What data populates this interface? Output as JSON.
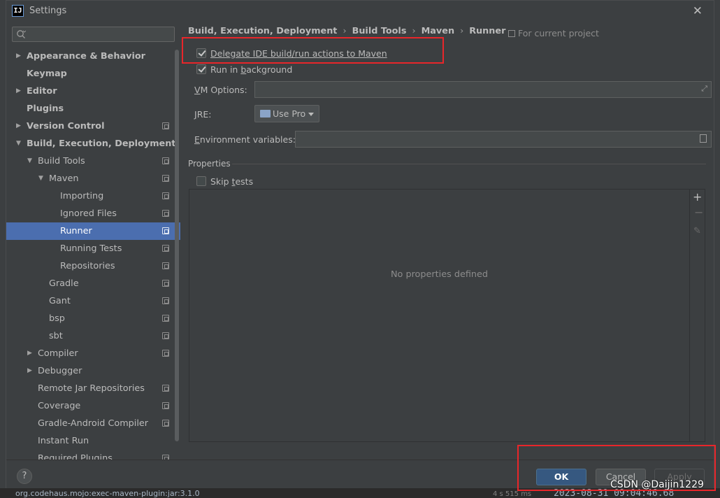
{
  "window": {
    "title": "Settings",
    "app_icon": "intellij-idea-icon"
  },
  "search": {
    "placeholder": ""
  },
  "nav": {
    "items": [
      {
        "label": "Appearance & Behavior",
        "level": 0,
        "arrow": "right",
        "bold": true,
        "project": false
      },
      {
        "label": "Keymap",
        "level": 0,
        "arrow": "",
        "bold": true,
        "project": false
      },
      {
        "label": "Editor",
        "level": 0,
        "arrow": "right",
        "bold": true,
        "project": false
      },
      {
        "label": "Plugins",
        "level": 0,
        "arrow": "",
        "bold": true,
        "project": false
      },
      {
        "label": "Version Control",
        "level": 0,
        "arrow": "right",
        "bold": true,
        "project": true
      },
      {
        "label": "Build, Execution, Deployment",
        "level": 0,
        "arrow": "down",
        "bold": true,
        "project": false
      },
      {
        "label": "Build Tools",
        "level": 1,
        "arrow": "down",
        "bold": false,
        "project": true
      },
      {
        "label": "Maven",
        "level": 2,
        "arrow": "down",
        "bold": false,
        "project": true
      },
      {
        "label": "Importing",
        "level": 3,
        "arrow": "",
        "bold": false,
        "project": true
      },
      {
        "label": "Ignored Files",
        "level": 3,
        "arrow": "",
        "bold": false,
        "project": true
      },
      {
        "label": "Runner",
        "level": 3,
        "arrow": "",
        "bold": false,
        "project": true,
        "selected": true
      },
      {
        "label": "Running Tests",
        "level": 3,
        "arrow": "",
        "bold": false,
        "project": true
      },
      {
        "label": "Repositories",
        "level": 3,
        "arrow": "",
        "bold": false,
        "project": true
      },
      {
        "label": "Gradle",
        "level": 2,
        "arrow": "",
        "bold": false,
        "project": true
      },
      {
        "label": "Gant",
        "level": 2,
        "arrow": "",
        "bold": false,
        "project": true
      },
      {
        "label": "bsp",
        "level": 2,
        "arrow": "",
        "bold": false,
        "project": true
      },
      {
        "label": "sbt",
        "level": 2,
        "arrow": "",
        "bold": false,
        "project": true
      },
      {
        "label": "Compiler",
        "level": 1,
        "arrow": "right",
        "bold": false,
        "project": true
      },
      {
        "label": "Debugger",
        "level": 1,
        "arrow": "right",
        "bold": false,
        "project": false
      },
      {
        "label": "Remote Jar Repositories",
        "level": 1,
        "arrow": "",
        "bold": false,
        "project": true
      },
      {
        "label": "Coverage",
        "level": 1,
        "arrow": "",
        "bold": false,
        "project": true
      },
      {
        "label": "Gradle-Android Compiler",
        "level": 1,
        "arrow": "",
        "bold": false,
        "project": true
      },
      {
        "label": "Instant Run",
        "level": 1,
        "arrow": "",
        "bold": false,
        "project": false
      },
      {
        "label": "Required Plugins",
        "level": 1,
        "arrow": "",
        "bold": false,
        "project": true
      }
    ]
  },
  "breadcrumb": [
    "Build, Execution, Deployment",
    "Build Tools",
    "Maven",
    "Runner"
  ],
  "scope_label": "For current project",
  "options": {
    "delegate": {
      "label": "Delegate IDE build/run actions to Maven",
      "checked": true
    },
    "background": {
      "label_pre": "Run in ",
      "label_u": "b",
      "label_post": "ackground",
      "checked": true
    },
    "vm_options": {
      "label_u": "V",
      "label_rest": "M Options:",
      "value": ""
    },
    "jre": {
      "label_u": "J",
      "label_rest": "RE:",
      "value": "Use Pro"
    },
    "env_vars": {
      "label_u": "E",
      "label_rest": "nvironment variables:",
      "value": ""
    }
  },
  "properties": {
    "section_title": "Properties",
    "skip_tests": {
      "label_pre": "Skip ",
      "label_u": "t",
      "label_post": "ests",
      "checked": false
    },
    "empty_text": "No properties defined"
  },
  "footer": {
    "help": "?",
    "ok": "OK",
    "cancel": "Cancel",
    "apply": "Apply"
  },
  "background_ide": {
    "bottom_text": "org.codehaus.mojo:exec-maven-plugin:jar:3.1.0",
    "bottom_time": "4 s 515 ms",
    "bottom_log": "2023-08-31 09:04:46.68"
  },
  "watermark": "CSDN @Daijin1229",
  "colors": {
    "selection": "#4b6eaf",
    "ok_button": "#365880",
    "annotation": "#e8262a"
  }
}
